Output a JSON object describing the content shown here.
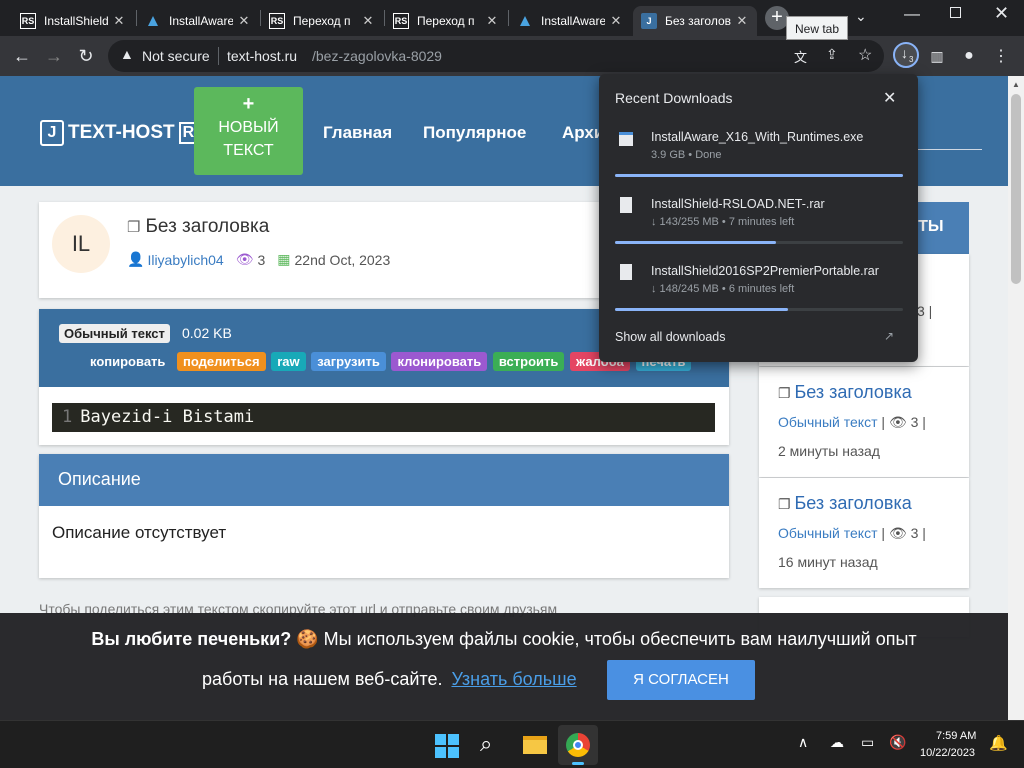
{
  "browser": {
    "tabs": [
      {
        "title": "InstallShield",
        "favicon": "RS"
      },
      {
        "title": "InstallAware",
        "favicon": "ia"
      },
      {
        "title": "Переход п",
        "favicon": "RS"
      },
      {
        "title": "Переход п",
        "favicon": "RS"
      },
      {
        "title": "InstallAware",
        "favicon": "ia"
      },
      {
        "title": "Без заголов",
        "favicon": "J"
      }
    ],
    "new_tab_tooltip": "New tab",
    "security": "Not secure",
    "url_host": "text-host.ru",
    "url_path": "/bez-zagolovka-8029",
    "download_count": "3"
  },
  "downloads": {
    "title": "Recent Downloads",
    "items": [
      {
        "name": "InstallAware_X16_With_Runtimes.exe",
        "status": "3.9 GB • Done",
        "progress": 1.0
      },
      {
        "name": "InstallShield-RSLOAD.NET-.rar",
        "status": "↓ 143/255 MB • 7 minutes left",
        "progress": 0.56
      },
      {
        "name": "InstallShield2016SP2PremierPortable.rar",
        "status": "↓ 148/245 MB • 6 minutes left",
        "progress": 0.6
      }
    ],
    "show_all": "Show all downloads"
  },
  "site": {
    "logo": "TEXT-HOST",
    "logo_ru": "RU",
    "new_text_plus": "+",
    "new_text_line1": "НОВЫЙ",
    "new_text_line2": "ТЕКСТ",
    "nav": [
      "Главная",
      "Популярное",
      "Архи"
    ]
  },
  "paste": {
    "avatar": "IL",
    "title": "Без заголовка",
    "author": "Iliyabylich04",
    "views": "3",
    "date": "22nd Oct, 2023",
    "type": "Обычный текст",
    "size": "0.02 KB",
    "actions": [
      {
        "label": "копировать",
        "color": "#3a6f9f"
      },
      {
        "label": "поделиться",
        "color": "#f0901d"
      },
      {
        "label": "raw",
        "color": "#18a9b8"
      },
      {
        "label": "загрузить",
        "color": "#4a8fd8"
      },
      {
        "label": "клонировать",
        "color": "#9b59d0"
      },
      {
        "label": "встроить",
        "color": "#3bae55"
      },
      {
        "label": "жалоба",
        "color": "#e54563"
      },
      {
        "label": "печать",
        "color": "#36b0d8"
      }
    ],
    "line_no": "1",
    "code": "Bayezid-i Bistami",
    "desc_header": "Описание",
    "desc_text": "Описание отсутствует",
    "share_text": "Чтобы поделиться этим текстом скопируйте этот url и отправьте своим друзьям"
  },
  "sidebar": {
    "header_fragment": "СТЫ",
    "items": [
      {
        "title": "Без заголовка",
        "type": "Обычный текст",
        "views": "3",
        "time": "2 минуты назад"
      },
      {
        "title": "Без заголовка",
        "type": "Обычный текст",
        "views": "3",
        "time": "16 минут назад"
      }
    ],
    "partial_title_top": "а",
    "partial_meta_top": "3 |"
  },
  "cookie": {
    "line1_bold": "Вы любите печеньки?",
    "line1_rest": "Мы используем файлы cookie, чтобы обеспечить вам наилучший опыт",
    "line2": "работы на нашем веб-сайте.",
    "learn_more": "Узнать больше",
    "agree": "Я СОГЛАСЕН"
  },
  "taskbar": {
    "time": "7:59 AM",
    "date": "10/22/2023"
  }
}
